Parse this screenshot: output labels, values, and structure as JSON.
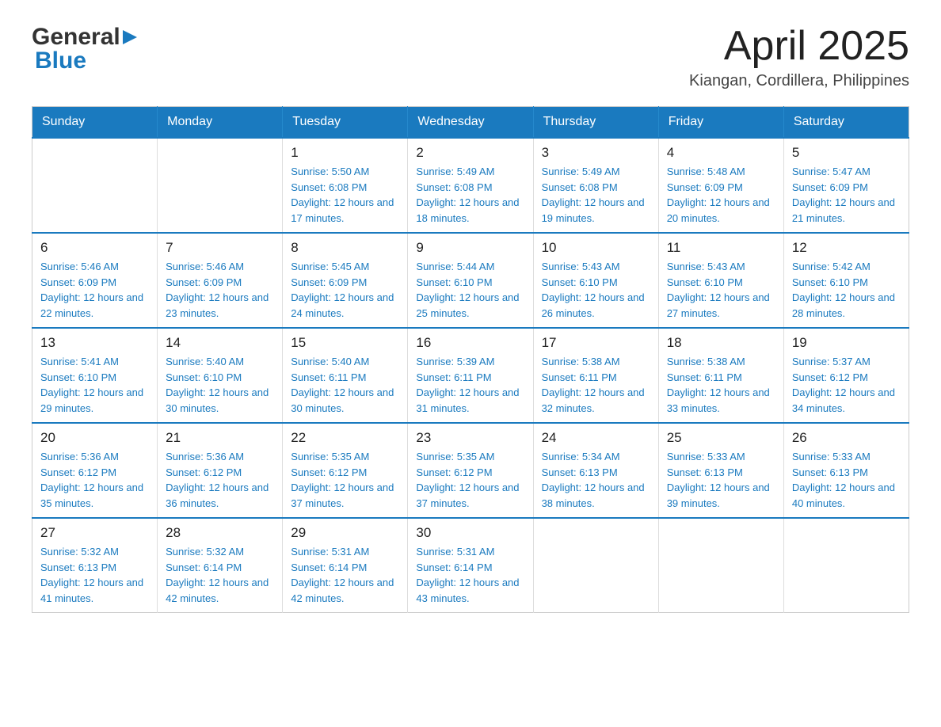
{
  "header": {
    "logo": {
      "general": "General",
      "blue": "Blue"
    },
    "title": "April 2025",
    "location": "Kiangan, Cordillera, Philippines"
  },
  "calendar": {
    "weekdays": [
      "Sunday",
      "Monday",
      "Tuesday",
      "Wednesday",
      "Thursday",
      "Friday",
      "Saturday"
    ],
    "weeks": [
      [
        {
          "day": "",
          "sunrise": "",
          "sunset": "",
          "daylight": ""
        },
        {
          "day": "",
          "sunrise": "",
          "sunset": "",
          "daylight": ""
        },
        {
          "day": "1",
          "sunrise": "Sunrise: 5:50 AM",
          "sunset": "Sunset: 6:08 PM",
          "daylight": "Daylight: 12 hours and 17 minutes."
        },
        {
          "day": "2",
          "sunrise": "Sunrise: 5:49 AM",
          "sunset": "Sunset: 6:08 PM",
          "daylight": "Daylight: 12 hours and 18 minutes."
        },
        {
          "day": "3",
          "sunrise": "Sunrise: 5:49 AM",
          "sunset": "Sunset: 6:08 PM",
          "daylight": "Daylight: 12 hours and 19 minutes."
        },
        {
          "day": "4",
          "sunrise": "Sunrise: 5:48 AM",
          "sunset": "Sunset: 6:09 PM",
          "daylight": "Daylight: 12 hours and 20 minutes."
        },
        {
          "day": "5",
          "sunrise": "Sunrise: 5:47 AM",
          "sunset": "Sunset: 6:09 PM",
          "daylight": "Daylight: 12 hours and 21 minutes."
        }
      ],
      [
        {
          "day": "6",
          "sunrise": "Sunrise: 5:46 AM",
          "sunset": "Sunset: 6:09 PM",
          "daylight": "Daylight: 12 hours and 22 minutes."
        },
        {
          "day": "7",
          "sunrise": "Sunrise: 5:46 AM",
          "sunset": "Sunset: 6:09 PM",
          "daylight": "Daylight: 12 hours and 23 minutes."
        },
        {
          "day": "8",
          "sunrise": "Sunrise: 5:45 AM",
          "sunset": "Sunset: 6:09 PM",
          "daylight": "Daylight: 12 hours and 24 minutes."
        },
        {
          "day": "9",
          "sunrise": "Sunrise: 5:44 AM",
          "sunset": "Sunset: 6:10 PM",
          "daylight": "Daylight: 12 hours and 25 minutes."
        },
        {
          "day": "10",
          "sunrise": "Sunrise: 5:43 AM",
          "sunset": "Sunset: 6:10 PM",
          "daylight": "Daylight: 12 hours and 26 minutes."
        },
        {
          "day": "11",
          "sunrise": "Sunrise: 5:43 AM",
          "sunset": "Sunset: 6:10 PM",
          "daylight": "Daylight: 12 hours and 27 minutes."
        },
        {
          "day": "12",
          "sunrise": "Sunrise: 5:42 AM",
          "sunset": "Sunset: 6:10 PM",
          "daylight": "Daylight: 12 hours and 28 minutes."
        }
      ],
      [
        {
          "day": "13",
          "sunrise": "Sunrise: 5:41 AM",
          "sunset": "Sunset: 6:10 PM",
          "daylight": "Daylight: 12 hours and 29 minutes."
        },
        {
          "day": "14",
          "sunrise": "Sunrise: 5:40 AM",
          "sunset": "Sunset: 6:10 PM",
          "daylight": "Daylight: 12 hours and 30 minutes."
        },
        {
          "day": "15",
          "sunrise": "Sunrise: 5:40 AM",
          "sunset": "Sunset: 6:11 PM",
          "daylight": "Daylight: 12 hours and 30 minutes."
        },
        {
          "day": "16",
          "sunrise": "Sunrise: 5:39 AM",
          "sunset": "Sunset: 6:11 PM",
          "daylight": "Daylight: 12 hours and 31 minutes."
        },
        {
          "day": "17",
          "sunrise": "Sunrise: 5:38 AM",
          "sunset": "Sunset: 6:11 PM",
          "daylight": "Daylight: 12 hours and 32 minutes."
        },
        {
          "day": "18",
          "sunrise": "Sunrise: 5:38 AM",
          "sunset": "Sunset: 6:11 PM",
          "daylight": "Daylight: 12 hours and 33 minutes."
        },
        {
          "day": "19",
          "sunrise": "Sunrise: 5:37 AM",
          "sunset": "Sunset: 6:12 PM",
          "daylight": "Daylight: 12 hours and 34 minutes."
        }
      ],
      [
        {
          "day": "20",
          "sunrise": "Sunrise: 5:36 AM",
          "sunset": "Sunset: 6:12 PM",
          "daylight": "Daylight: 12 hours and 35 minutes."
        },
        {
          "day": "21",
          "sunrise": "Sunrise: 5:36 AM",
          "sunset": "Sunset: 6:12 PM",
          "daylight": "Daylight: 12 hours and 36 minutes."
        },
        {
          "day": "22",
          "sunrise": "Sunrise: 5:35 AM",
          "sunset": "Sunset: 6:12 PM",
          "daylight": "Daylight: 12 hours and 37 minutes."
        },
        {
          "day": "23",
          "sunrise": "Sunrise: 5:35 AM",
          "sunset": "Sunset: 6:12 PM",
          "daylight": "Daylight: 12 hours and 37 minutes."
        },
        {
          "day": "24",
          "sunrise": "Sunrise: 5:34 AM",
          "sunset": "Sunset: 6:13 PM",
          "daylight": "Daylight: 12 hours and 38 minutes."
        },
        {
          "day": "25",
          "sunrise": "Sunrise: 5:33 AM",
          "sunset": "Sunset: 6:13 PM",
          "daylight": "Daylight: 12 hours and 39 minutes."
        },
        {
          "day": "26",
          "sunrise": "Sunrise: 5:33 AM",
          "sunset": "Sunset: 6:13 PM",
          "daylight": "Daylight: 12 hours and 40 minutes."
        }
      ],
      [
        {
          "day": "27",
          "sunrise": "Sunrise: 5:32 AM",
          "sunset": "Sunset: 6:13 PM",
          "daylight": "Daylight: 12 hours and 41 minutes."
        },
        {
          "day": "28",
          "sunrise": "Sunrise: 5:32 AM",
          "sunset": "Sunset: 6:14 PM",
          "daylight": "Daylight: 12 hours and 42 minutes."
        },
        {
          "day": "29",
          "sunrise": "Sunrise: 5:31 AM",
          "sunset": "Sunset: 6:14 PM",
          "daylight": "Daylight: 12 hours and 42 minutes."
        },
        {
          "day": "30",
          "sunrise": "Sunrise: 5:31 AM",
          "sunset": "Sunset: 6:14 PM",
          "daylight": "Daylight: 12 hours and 43 minutes."
        },
        {
          "day": "",
          "sunrise": "",
          "sunset": "",
          "daylight": ""
        },
        {
          "day": "",
          "sunrise": "",
          "sunset": "",
          "daylight": ""
        },
        {
          "day": "",
          "sunrise": "",
          "sunset": "",
          "daylight": ""
        }
      ]
    ]
  }
}
